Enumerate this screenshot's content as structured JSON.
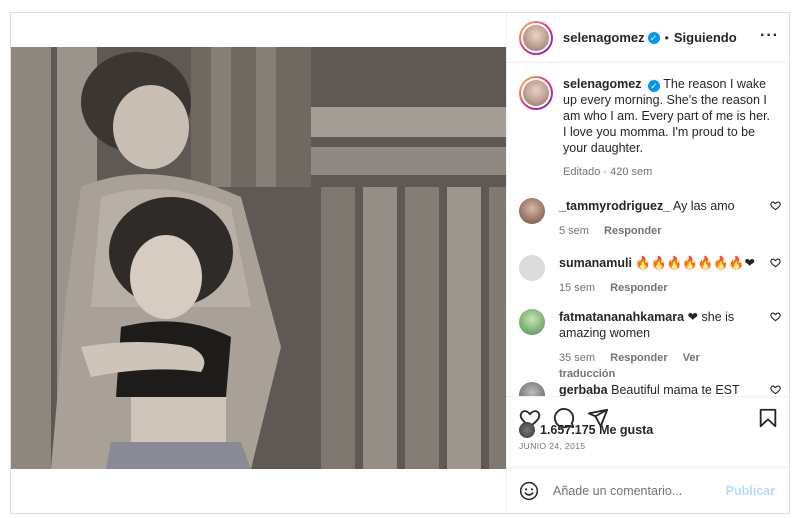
{
  "header": {
    "username": "selenagomez",
    "separator": "•",
    "follow_label": "Siguiendo",
    "more_icon": "more-icon"
  },
  "caption": {
    "username": "selenagomez",
    "text": "The reason I wake up every morning. She's the reason I am who I am. Every part of me is her. I love you momma. I'm proud to be your daughter.",
    "meta": "Editado · 420 sem"
  },
  "comments": [
    {
      "username": "_tammyrodriguez_",
      "text": "Ay las amo",
      "time": "5 sem",
      "reply": "Responder",
      "translate": ""
    },
    {
      "username": "sumanamuli",
      "text": "🔥🔥🔥🔥🔥🔥🔥❤",
      "time": "15 sem",
      "reply": "Responder",
      "translate": ""
    },
    {
      "username": "fatmatananahkamara",
      "text": "❤ she is amazing women",
      "time": "35 sem",
      "reply": "Responder",
      "translate": "Ver traducción"
    },
    {
      "username": "gerbaba",
      "text": "Beautiful mama te EST",
      "time": "",
      "reply": "",
      "translate": ""
    }
  ],
  "stats": {
    "likes": "1.657.175 Me gusta",
    "date": "JUNIO 24, 2015"
  },
  "composer": {
    "placeholder": "Añade un comentario...",
    "post_label": "Publicar"
  },
  "colors": {
    "accent": "#0095f6",
    "post_disabled": "#b3dbff",
    "like_red": "#ed4956"
  }
}
